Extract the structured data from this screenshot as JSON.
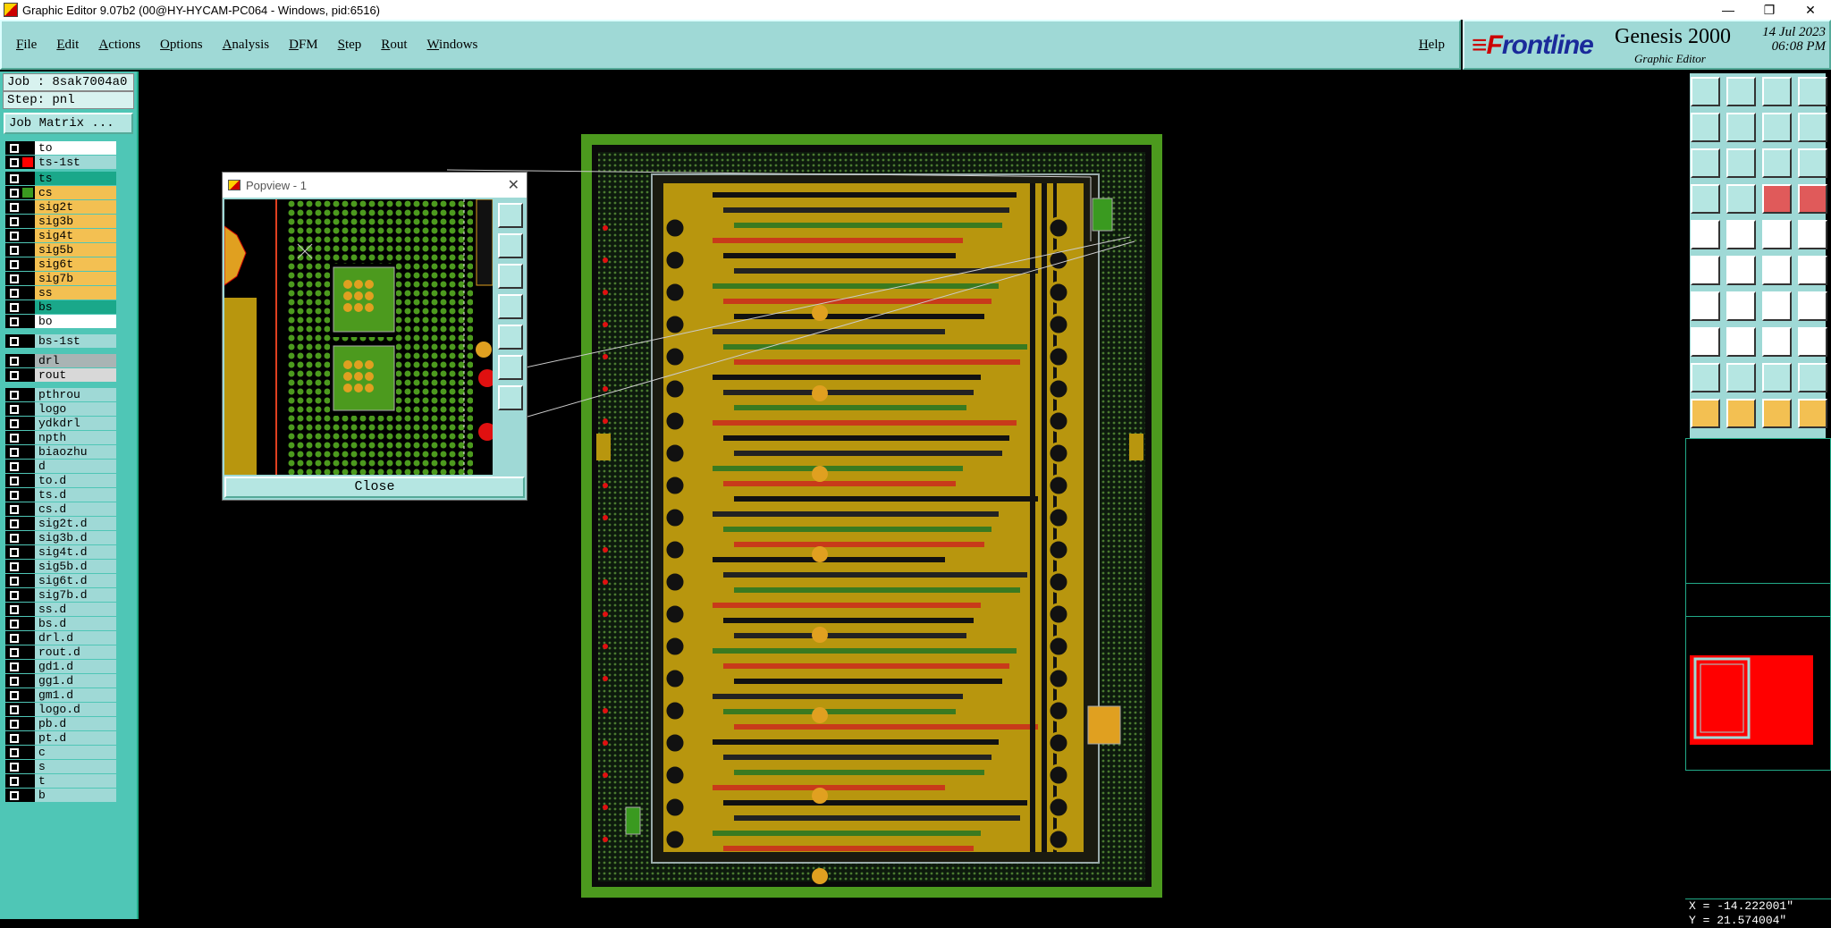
{
  "window": {
    "title": "Graphic Editor 9.07b2 (00@HY-HYCAM-PC064 - Windows, pid:6516)",
    "min": "—",
    "restore": "❐",
    "close": "✕"
  },
  "menu": [
    "File",
    "Edit",
    "Actions",
    "Options",
    "Analysis",
    "DFM",
    "Step",
    "Rout",
    "Windows"
  ],
  "help": "Help",
  "brand": {
    "logo_f": "≡F",
    "logo_rest": "rontline",
    "product": "Genesis 2000",
    "subtitle": "Graphic Editor",
    "date": "14 Jul 2023",
    "time": "06:08 PM"
  },
  "job": {
    "job": "Job : 8sak7004a0",
    "step": "Step: pnl",
    "matrix_button": "Job Matrix ..."
  },
  "layers": [
    {
      "name": "to",
      "color": "#ffffff",
      "swatch": ""
    },
    {
      "name": "ts-1st",
      "color": "#9fd9d6",
      "swatch": "#ff0000"
    },
    {
      "name": "ts",
      "color": "#1aa88a",
      "swatch": ""
    },
    {
      "name": "cs",
      "color": "#f3c052",
      "swatch": "#3a9a20"
    },
    {
      "name": "sig2t",
      "color": "#f3c052",
      "swatch": ""
    },
    {
      "name": "sig3b",
      "color": "#f3c052",
      "swatch": ""
    },
    {
      "name": "sig4t",
      "color": "#f3c052",
      "swatch": ""
    },
    {
      "name": "sig5b",
      "color": "#f3c052",
      "swatch": ""
    },
    {
      "name": "sig6t",
      "color": "#f3c052",
      "swatch": ""
    },
    {
      "name": "sig7b",
      "color": "#f3c052",
      "swatch": ""
    },
    {
      "name": "ss",
      "color": "#f3c052",
      "swatch": ""
    },
    {
      "name": "bs",
      "color": "#1aa88a",
      "swatch": ""
    },
    {
      "name": "bo",
      "color": "#ffffff",
      "swatch": ""
    },
    {
      "name": "bs-1st",
      "color": "#9fd9d6",
      "swatch": ""
    },
    {
      "name": "drl",
      "color": "#a9b4b4",
      "swatch": ""
    },
    {
      "name": "rout",
      "color": "#d8d8d8",
      "swatch": ""
    },
    {
      "name": "pthrou",
      "color": "#9fd9d6",
      "swatch": ""
    },
    {
      "name": "logo",
      "color": "#9fd9d6",
      "swatch": ""
    },
    {
      "name": "ydkdrl",
      "color": "#9fd9d6",
      "swatch": ""
    },
    {
      "name": "npth",
      "color": "#9fd9d6",
      "swatch": ""
    },
    {
      "name": "biaozhu",
      "color": "#9fd9d6",
      "swatch": ""
    },
    {
      "name": "d",
      "color": "#9fd9d6",
      "swatch": ""
    },
    {
      "name": "to.d",
      "color": "#9fd9d6",
      "swatch": ""
    },
    {
      "name": "ts.d",
      "color": "#9fd9d6",
      "swatch": ""
    },
    {
      "name": "cs.d",
      "color": "#9fd9d6",
      "swatch": ""
    },
    {
      "name": "sig2t.d",
      "color": "#9fd9d6",
      "swatch": ""
    },
    {
      "name": "sig3b.d",
      "color": "#9fd9d6",
      "swatch": ""
    },
    {
      "name": "sig4t.d",
      "color": "#9fd9d6",
      "swatch": ""
    },
    {
      "name": "sig5b.d",
      "color": "#9fd9d6",
      "swatch": ""
    },
    {
      "name": "sig6t.d",
      "color": "#9fd9d6",
      "swatch": ""
    },
    {
      "name": "sig7b.d",
      "color": "#9fd9d6",
      "swatch": ""
    },
    {
      "name": "ss.d",
      "color": "#9fd9d6",
      "swatch": ""
    },
    {
      "name": "bs.d",
      "color": "#9fd9d6",
      "swatch": ""
    },
    {
      "name": "drl.d",
      "color": "#9fd9d6",
      "swatch": ""
    },
    {
      "name": "rout.d",
      "color": "#9fd9d6",
      "swatch": ""
    },
    {
      "name": "gd1.d",
      "color": "#9fd9d6",
      "swatch": ""
    },
    {
      "name": "gg1.d",
      "color": "#9fd9d6",
      "swatch": ""
    },
    {
      "name": "gm1.d",
      "color": "#9fd9d6",
      "swatch": ""
    },
    {
      "name": "logo.d",
      "color": "#9fd9d6",
      "swatch": ""
    },
    {
      "name": "pb.d",
      "color": "#9fd9d6",
      "swatch": ""
    },
    {
      "name": "pt.d",
      "color": "#9fd9d6",
      "swatch": ""
    },
    {
      "name": "c",
      "color": "#9fd9d6",
      "swatch": ""
    },
    {
      "name": "s",
      "color": "#9fd9d6",
      "swatch": ""
    },
    {
      "name": "t",
      "color": "#9fd9d6",
      "swatch": ""
    },
    {
      "name": "b",
      "color": "#9fd9d6",
      "swatch": ""
    }
  ],
  "popview": {
    "title": "Popview - 1",
    "close_button": "Close"
  },
  "toolbar_icons": [
    "open-job-icon",
    "save-icon",
    "home-icon",
    "layout-icon",
    "import-icon",
    "export-icon",
    "step-icon",
    "route-icon",
    "zoom-fit-icon",
    "pan-icon",
    "scale-1-2-icon",
    "help-query-icon",
    "measure-icon",
    "grid-icon",
    "net-icon",
    "net-highlight-icon",
    "add-pad-icon",
    "line-icon",
    "slot-icon",
    "circle-icon",
    "connect-icon",
    "delete-icon",
    "move-icon",
    "point-icon",
    "angle-icon",
    "cut-icon",
    "arc-icon",
    "stub-icon",
    "snap-icon",
    "dash-icon",
    "dimension-icon",
    "copy-icon",
    "triangle-icon",
    "triangle-alt-icon",
    "triangle-a-icon",
    "triangle-b-icon",
    "select-icon",
    "select-box-icon",
    "select-move-icon",
    "select-multi-icon"
  ],
  "status": {
    "coord_x": "X = -14.222001\"",
    "coord_y": "Y =  21.574004\""
  },
  "colors": {
    "panel": "#9fd9d6",
    "accent": "#4fc6b6",
    "board_green": "#3a9a20",
    "copper": "#b8960e",
    "pad_red": "#e01010"
  }
}
